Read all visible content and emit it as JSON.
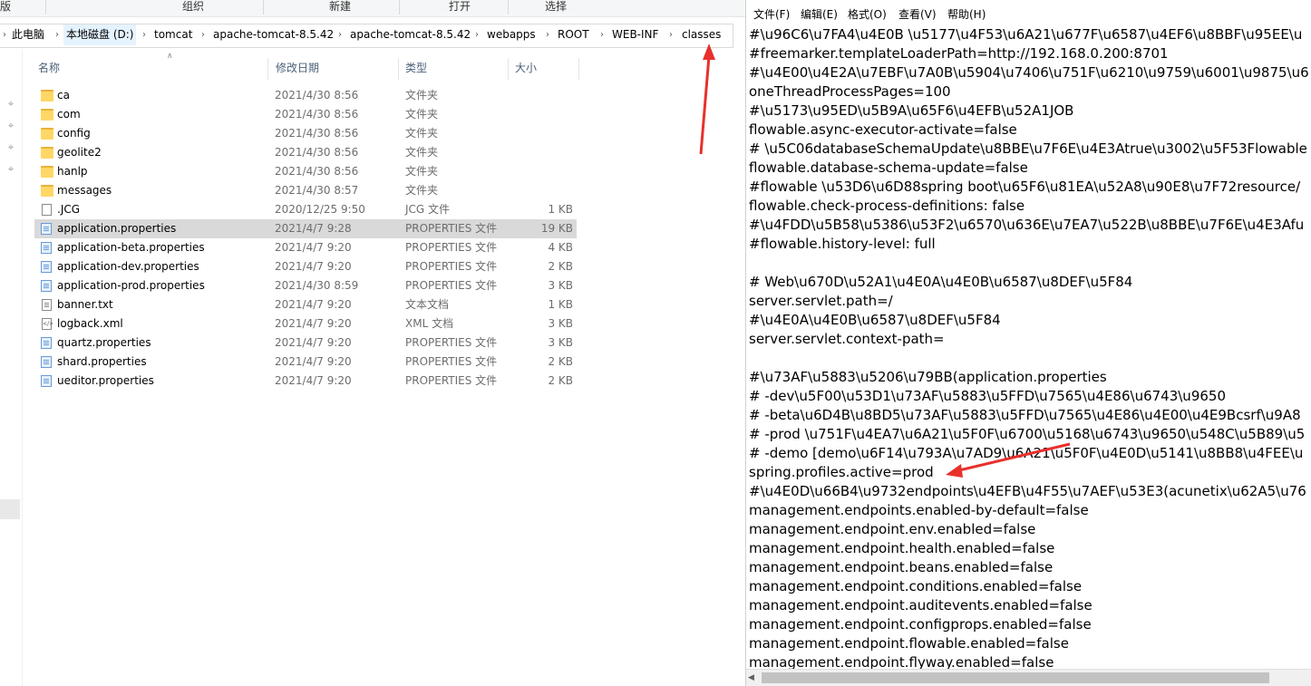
{
  "explorer": {
    "ribbon_groups": [
      "版",
      "组织",
      "新建",
      "打开",
      "选择"
    ],
    "breadcrumbs": [
      "此电脑",
      "本地磁盘 (D:)",
      "tomcat",
      "apache-tomcat-8.5.42",
      "apache-tomcat-8.5.42",
      "webapps",
      "ROOT",
      "WEB-INF",
      "classes"
    ],
    "columns": {
      "name": "名称",
      "date": "修改日期",
      "type": "类型",
      "size": "大小"
    },
    "files": [
      {
        "name": "ca",
        "date": "2021/4/30 8:56",
        "type": "文件夹",
        "size": "",
        "icon": "folder-icon"
      },
      {
        "name": "com",
        "date": "2021/4/30 8:56",
        "type": "文件夹",
        "size": "",
        "icon": "folder-icon"
      },
      {
        "name": "config",
        "date": "2021/4/30 8:56",
        "type": "文件夹",
        "size": "",
        "icon": "folder-icon"
      },
      {
        "name": "geolite2",
        "date": "2021/4/30 8:56",
        "type": "文件夹",
        "size": "",
        "icon": "folder-icon"
      },
      {
        "name": "hanlp",
        "date": "2021/4/30 8:56",
        "type": "文件夹",
        "size": "",
        "icon": "folder-icon"
      },
      {
        "name": "messages",
        "date": "2021/4/30 8:57",
        "type": "文件夹",
        "size": "",
        "icon": "folder-icon"
      },
      {
        "name": ".JCG",
        "date": "2020/12/25 9:50",
        "type": "JCG 文件",
        "size": "1 KB",
        "icon": "file-icon"
      },
      {
        "name": "application.properties",
        "date": "2021/4/7 9:28",
        "type": "PROPERTIES 文件",
        "size": "19 KB",
        "icon": "properties-file-icon",
        "selected": true
      },
      {
        "name": "application-beta.properties",
        "date": "2021/4/7 9:20",
        "type": "PROPERTIES 文件",
        "size": "4 KB",
        "icon": "properties-file-icon"
      },
      {
        "name": "application-dev.properties",
        "date": "2021/4/7 9:20",
        "type": "PROPERTIES 文件",
        "size": "2 KB",
        "icon": "properties-file-icon"
      },
      {
        "name": "application-prod.properties",
        "date": "2021/4/30 8:59",
        "type": "PROPERTIES 文件",
        "size": "3 KB",
        "icon": "properties-file-icon"
      },
      {
        "name": "banner.txt",
        "date": "2021/4/7 9:20",
        "type": "文本文档",
        "size": "1 KB",
        "icon": "text-file-icon"
      },
      {
        "name": "logback.xml",
        "date": "2021/4/7 9:20",
        "type": "XML 文档",
        "size": "3 KB",
        "icon": "xml-file-icon"
      },
      {
        "name": "quartz.properties",
        "date": "2021/4/7 9:20",
        "type": "PROPERTIES 文件",
        "size": "3 KB",
        "icon": "properties-file-icon"
      },
      {
        "name": "shard.properties",
        "date": "2021/4/7 9:20",
        "type": "PROPERTIES 文件",
        "size": "2 KB",
        "icon": "properties-file-icon"
      },
      {
        "name": "ueditor.properties",
        "date": "2021/4/7 9:20",
        "type": "PROPERTIES 文件",
        "size": "2 KB",
        "icon": "properties-file-icon"
      }
    ]
  },
  "notepad": {
    "menu": [
      "文件(F)",
      "编辑(E)",
      "格式(O)",
      "查看(V)",
      "帮助(H)"
    ],
    "lines": [
      "#\\u96C6\\u7FA4\\u4E0B \\u5177\\u4F53\\u6A21\\u677F\\u6587\\u4EF6\\u8BBF\\u95EE\\u",
      "#freemarker.templateLoaderPath=http://192.168.0.200:8701",
      "#\\u4E00\\u4E2A\\u7EBF\\u7A0B\\u5904\\u7406\\u751F\\u6210\\u9759\\u6001\\u9875\\u6",
      "oneThreadProcessPages=100",
      "#\\u5173\\u95ED\\u5B9A\\u65F6\\u4EFB\\u52A1JOB",
      "flowable.async-executor-activate=false",
      "# \\u5C06databaseSchemaUpdate\\u8BBE\\u7F6E\\u4E3Atrue\\u3002\\u5F53Flowable",
      "flowable.database-schema-update=false",
      "#flowable \\u53D6\\u6D88spring boot\\u65F6\\u81EA\\u52A8\\u90E8\\u7F72resource/",
      "flowable.check-process-definitions: false",
      "#\\u4FDD\\u5B58\\u5386\\u53F2\\u6570\\u636E\\u7EA7\\u522B\\u8BBE\\u7F6E\\u4E3Afu",
      "#flowable.history-level: full",
      "",
      "# Web\\u670D\\u52A1\\u4E0A\\u4E0B\\u6587\\u8DEF\\u5F84",
      "server.servlet.path=/",
      "#\\u4E0A\\u4E0B\\u6587\\u8DEF\\u5F84",
      "server.servlet.context-path=",
      "",
      "#\\u73AF\\u5883\\u5206\\u79BB(application.properties",
      "# -dev\\u5F00\\u53D1\\u73AF\\u5883\\u5FFD\\u7565\\u4E86\\u6743\\u9650",
      "# -beta\\u6D4B\\u8BD5\\u73AF\\u5883\\u5FFD\\u7565\\u4E86\\u4E00\\u4E9Bcsrf\\u9A8",
      "# -prod \\u751F\\u4EA7\\u6A21\\u5F0F\\u6700\\u5168\\u6743\\u9650\\u548C\\u5B89\\u5",
      "# -demo [demo\\u6F14\\u793A\\u7AD9\\u6A21\\u5F0F\\u4E0D\\u5141\\u8BB8\\u4FEE\\u",
      "spring.profiles.active=prod",
      "#\\u4E0D\\u66B4\\u9732endpoints\\u4EFB\\u4F55\\u7AEF\\u53E3(acunetix\\u62A5\\u76",
      "management.endpoints.enabled-by-default=false",
      "management.endpoint.env.enabled=false",
      "management.endpoint.health.enabled=false",
      "management.endpoint.beans.enabled=false",
      "management.endpoint.conditions.enabled=false",
      "management.endpoint.auditevents.enabled=false",
      "management.endpoint.configprops.enabled=false",
      "management.endpoint.flowable.enabled=false",
      "management.endpoint.flyway.enabled=false"
    ]
  },
  "colors": {
    "selection": "#d9d9d9",
    "breadcrumb_highlight": "#e5f3ff",
    "annotation_arrow": "#e8302c"
  }
}
